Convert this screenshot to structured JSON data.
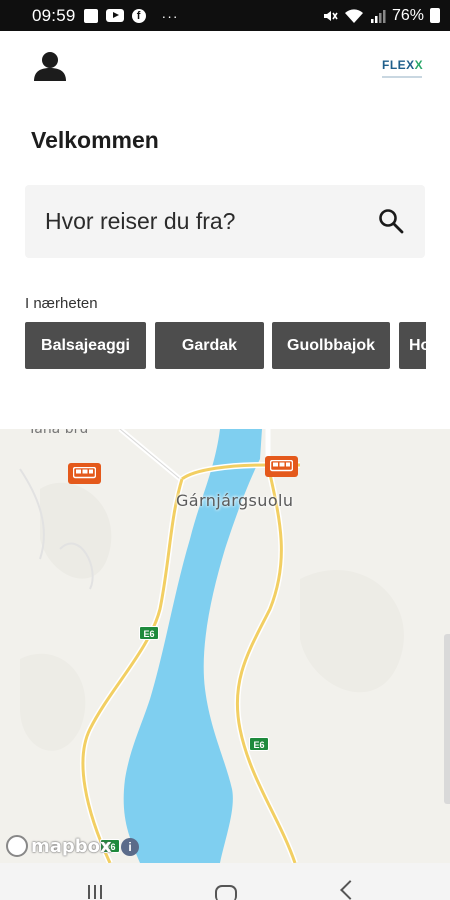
{
  "status_bar": {
    "time": "09:59",
    "notification_icons": [
      "gallery-icon",
      "youtube-icon",
      "facebook-icon"
    ],
    "overflow": "···",
    "battery_percent": "76%"
  },
  "header": {
    "logo_text": "FLEX",
    "logo_text_accent": "X",
    "welcome": "Velkommen"
  },
  "search": {
    "placeholder": "Hvor reiser du fra?"
  },
  "nearby": {
    "label": "I nærheten",
    "stops": [
      "Balsajeaggi",
      "Gardak",
      "Guolbbajok",
      "Ho"
    ]
  },
  "map": {
    "place_name": "Gárnjárgsuolu",
    "top_label": "Tana bru",
    "road_shield": "E6",
    "attribution": "mapbox",
    "info_label": "i",
    "colors": {
      "land": "#f2f1ec",
      "water": "#7fcff0",
      "road": "#f2cf63",
      "bus_marker": "#e4591b"
    }
  },
  "navbar": {
    "buttons": [
      "recents-button",
      "home-button",
      "back-button"
    ]
  }
}
